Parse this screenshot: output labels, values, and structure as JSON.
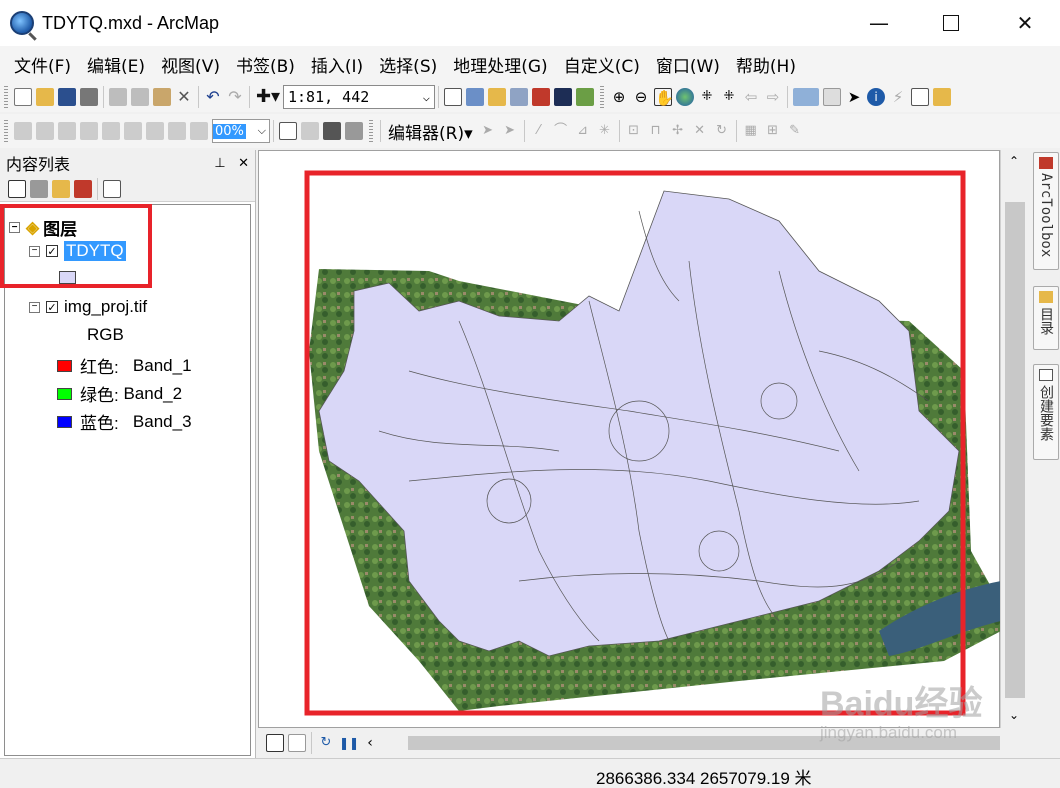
{
  "window": {
    "title": "TDYTQ.mxd - ArcMap"
  },
  "menu": [
    "文件(F)",
    "编辑(E)",
    "视图(V)",
    "书签(B)",
    "插入(I)",
    "选择(S)",
    "地理处理(G)",
    "自定义(C)",
    "窗口(W)",
    "帮助(H)"
  ],
  "toolbar": {
    "scale": "1:81, 442",
    "zoom_field": "00%",
    "editor_label": "编辑器(R)"
  },
  "toc": {
    "title": "内容列表",
    "pin": "ᵖ",
    "close": "✕",
    "root": "图层",
    "layer1": "TDYTQ",
    "layer2": "img_proj.tif",
    "rgb": "RGB",
    "bands": [
      {
        "label": "红色:",
        "band": "Band_1",
        "color": "#ff0000"
      },
      {
        "label": "绿色:",
        "band": "Band_2",
        "color": "#00ff00"
      },
      {
        "label": "蓝色:",
        "band": "Band_3",
        "color": "#0000ff"
      }
    ]
  },
  "dock": {
    "arctoolbox": "ArcToolbox",
    "catalog": "目录",
    "create_features": "创建要素"
  },
  "status": {
    "coords": "2866386.334  2657079.19 米"
  },
  "watermark": {
    "brand": "Baidu经验",
    "url": "jingyan.baidu.com"
  },
  "colors": {
    "polygon_fill": "#d9d7f7",
    "highlight": "#3399ff",
    "annotation": "#e8232a"
  }
}
